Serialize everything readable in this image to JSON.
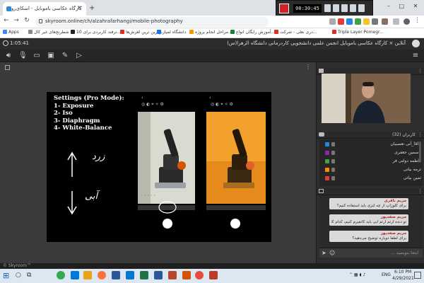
{
  "browser": {
    "tab_title": "کارگاه عکاسی باموبایل - اسکای‌روم",
    "url": "skyroom.online/ch/alzahrafarhangi/mobile-photography",
    "bookmarks": [
      {
        "label": "Apps",
        "color": "#4285f4"
      },
      {
        "label": "شطرنج‌های غیر کال",
        "color": "#888"
      },
      {
        "label": "10 ترفند کاربردی برای...",
        "color": "#222"
      },
      {
        "label": "بهترین ترین لغزش‌ها...",
        "color": "#d93025"
      },
      {
        "label": "دانشگاه لمپاز",
        "color": "#1a73e8"
      },
      {
        "label": "مراحل انجام پروژه...",
        "color": "#f29900"
      },
      {
        "label": "آموزش رایگان انواع...",
        "color": "#188038"
      },
      {
        "label": "دری نعلی - شرکت...",
        "color": "#d93025"
      },
      {
        "label": "Triple Layer Pomegr...",
        "color": "#d93025"
      }
    ]
  },
  "recorder": {
    "timer": "00:30:45"
  },
  "room": {
    "title": "آنلاین × کارگاه عکاسی باموبایل انجمن علمی دانشجویی کاردرمانی دانشگاه الزهرا(س)",
    "elapsed": "1:05:41"
  },
  "slide": {
    "title_lines": [
      "Settings (Pro Mode):",
      "1- Exposure",
      "2- Iso",
      "3- Diaphragm",
      "4- White-Balance"
    ],
    "handwritten_top": "زرد",
    "handwritten_bottom": "آبی"
  },
  "users_panel": {
    "header": "کاربران (32)",
    "users": [
      {
        "name": "lala_آنی تعصبیان",
        "color": "#1e88e5"
      },
      {
        "name": "یاسمین جعفری",
        "color": "#8e24aa"
      },
      {
        "name": "فاطمه دولتی فر",
        "color": "#43a047"
      },
      {
        "name": "ترمه بیاتی",
        "color": "#fb8c00"
      },
      {
        "name": "ثمین بیاتی",
        "color": "#e53935"
      }
    ]
  },
  "chat": {
    "header": "گفتگو",
    "messages": [
      {
        "author": "مریم باقری",
        "text": "برای کلوزاپ از چه لنزی باید استفاده کنیم؟"
      },
      {
        "author": "مریم صفدپور",
        "text": "تو دنده آرتم آرتم آبی باید کانفیرم کنیم، کدام کلیک مسود؟"
      },
      {
        "author": "مریم صفدپور",
        "text": "برای لطفاً دوباره توضیح می‌دهید؟"
      }
    ],
    "input_placeholder": "اینجا بنویسید ..."
  },
  "status_bar": {
    "text": "© Skyroom™"
  },
  "taskbar": {
    "time": "6:10 PM",
    "date": "4/29/2021",
    "lang": "ENG"
  }
}
